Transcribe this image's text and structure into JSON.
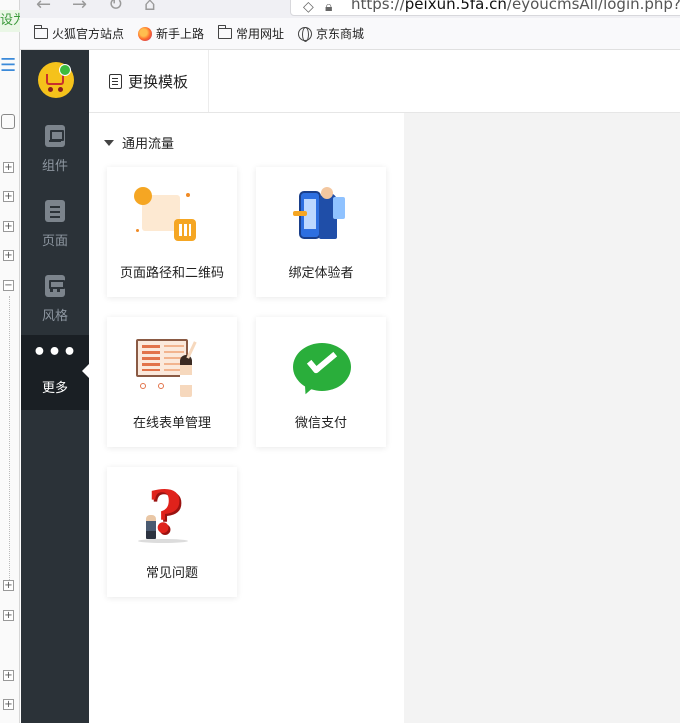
{
  "browser": {
    "url_prefix": "https://",
    "url_host": "peixun.5fa.cn",
    "url_path": "/eyoucmsAll/login.php?m=ac",
    "bookmarks": [
      {
        "label": "火狐官方站点",
        "icon": "folder-icon"
      },
      {
        "label": "新手上路",
        "icon": "firefox-icon"
      },
      {
        "label": "常用网址",
        "icon": "folder-icon"
      },
      {
        "label": "京东商城",
        "icon": "globe-icon"
      }
    ]
  },
  "left_strip": {
    "top_text": "设为"
  },
  "nav": {
    "items": [
      {
        "label": "组件",
        "icon": "widget-icon"
      },
      {
        "label": "页面",
        "icon": "page-icon"
      },
      {
        "label": "风格",
        "icon": "style-icon"
      },
      {
        "label": "更多",
        "icon": "more-dots-icon",
        "active": true
      }
    ]
  },
  "topbar": {
    "template_label": "更换模板"
  },
  "panel": {
    "section_title": "通用流量",
    "cards": [
      {
        "label": "页面路径和二维码",
        "icon": "qr-path-illustration"
      },
      {
        "label": "绑定体验者",
        "icon": "bind-tester-illustration"
      },
      {
        "label": "在线表单管理",
        "icon": "online-form-illustration"
      },
      {
        "label": "微信支付",
        "icon": "wechat-pay-icon"
      },
      {
        "label": "常见问题",
        "icon": "faq-question-illustration"
      }
    ]
  },
  "colors": {
    "sidebar_bg": "#2b3238",
    "sidebar_active_bg": "#1a1f24",
    "canvas_bg": "#f3f3f3",
    "wechat_green": "#2aae3b",
    "faq_red": "#e0221b",
    "accent_orange": "#f5a623"
  }
}
